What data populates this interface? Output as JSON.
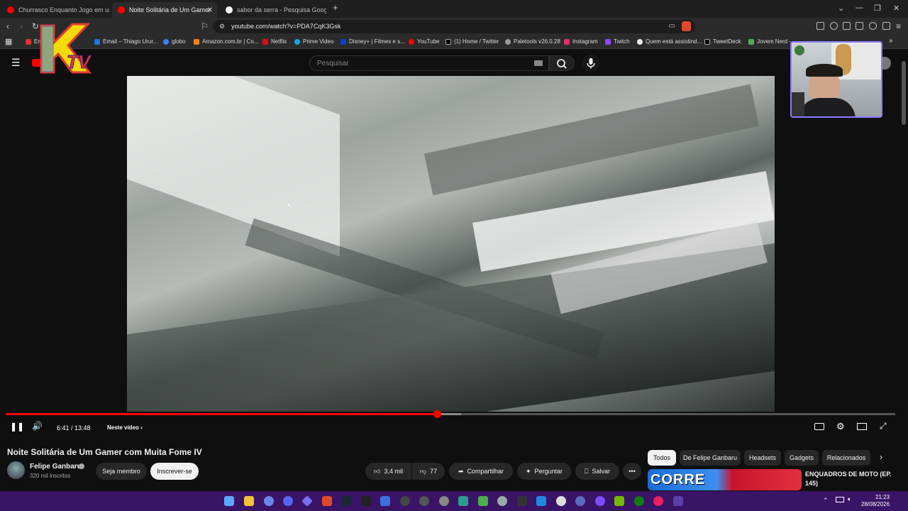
{
  "browser": {
    "tabs": [
      {
        "label": "Churrasco Enquanto Jogo em uma N",
        "active": false
      },
      {
        "label": "Noite Solitária de Um Gamer",
        "active": true
      },
      {
        "label": "sabor da serra - Pesquisa Google",
        "active": false
      }
    ],
    "new_tab": "+",
    "url": "youtube.com/watch?v=PDA7CqK3Gsk",
    "bookmarks": [
      "Em",
      "Email – Thiago Urur...",
      "globo",
      "Amazon.com.br | Co...",
      "Netflix",
      "Prime Video",
      "Disney+ | Filmes e s...",
      "YouTube",
      "(1) Home / Twitter",
      "Paletools v26.0.28",
      "Instagram",
      "Twitch",
      "Quem está assistind...",
      "TweetDeck",
      "Jovem Nerd -"
    ]
  },
  "youtube": {
    "search_placeholder": "Pesquisar",
    "player": {
      "time": "6:41 / 13:48",
      "chapter": "Neste vídeo",
      "progress": 0.4845,
      "buffered": 0.512
    },
    "video_title": "Noite Solitária de Um Gamer com Muita Fome IV",
    "channel": {
      "name": "Felipe Ganbaru",
      "subscribers": "320 mil inscritos",
      "join_label": "Seja membro",
      "subscribe_label": "Inscrever-se"
    },
    "actions": {
      "likes": "3,4 mil",
      "dislikes": "77",
      "share": "Compartilhar",
      "ask": "Perguntar",
      "save": "Salvar"
    },
    "chips": [
      "Todos",
      "De Felipe Ganbaru",
      "Headsets",
      "Gadgets",
      "Relacionados"
    ],
    "recommendation": {
      "thumb_text": "CORRE",
      "title": "ENQUADROS DE MOTO (EP.",
      "title2": "145)"
    }
  },
  "overlay": {
    "logo_letters": "KTV"
  },
  "taskbar": {
    "time": "21:23",
    "date": "28/08/2026"
  },
  "colors": {
    "accent": "#ff0000",
    "taskbar": "#3a1466",
    "webcam_border": "#8a7cff"
  }
}
